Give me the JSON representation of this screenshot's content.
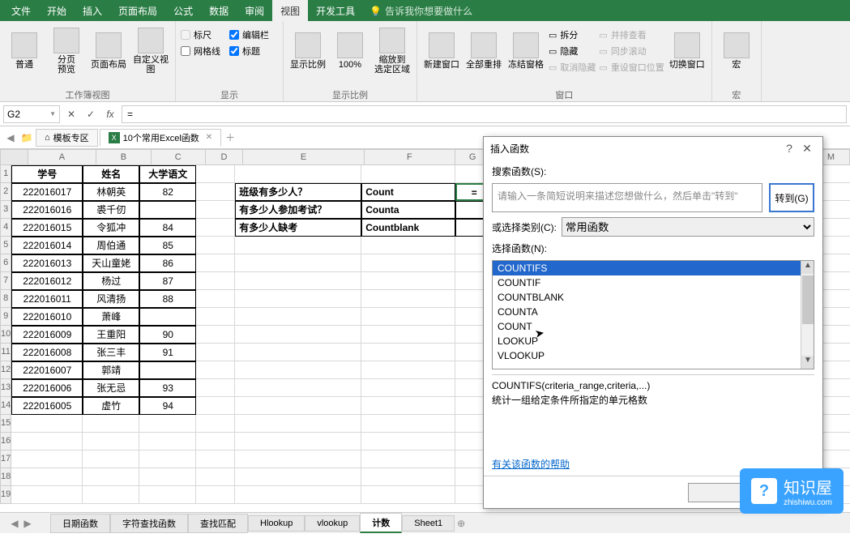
{
  "menu": {
    "tabs": [
      "文件",
      "开始",
      "插入",
      "页面布局",
      "公式",
      "数据",
      "审阅",
      "视图",
      "开发工具"
    ],
    "active": "视图",
    "tellme": "告诉我你想要做什么"
  },
  "ribbon": {
    "group1": {
      "label": "工作簿视图",
      "btns": [
        "普通",
        "分页\n预览",
        "页面布局",
        "自定义视图"
      ]
    },
    "group2": {
      "label": "显示",
      "chks": [
        "标尺",
        "编辑栏",
        "网格线",
        "标题"
      ]
    },
    "group3": {
      "label": "显示比例",
      "btns": [
        "显示比例",
        "100%",
        "缩放到\n选定区域"
      ]
    },
    "group4": {
      "label": "窗口",
      "btns": [
        "新建窗口",
        "全部重排",
        "冻结窗格"
      ],
      "rcol": [
        "拆分",
        "隐藏",
        "取消隐藏"
      ],
      "rcol2": [
        "并排查看",
        "同步滚动",
        "重设窗口位置"
      ],
      "switch": "切换窗口"
    },
    "group5": {
      "label": "宏",
      "btn": "宏"
    }
  },
  "formulaBar": {
    "nameBox": "G2",
    "formula": "="
  },
  "wbtabs": {
    "tab1": "模板专区",
    "tab2": "10个常用Excel函数"
  },
  "cols": [
    "A",
    "B",
    "C",
    "D",
    "E",
    "F",
    "G",
    "M"
  ],
  "grid": {
    "headers": {
      "A": "学号",
      "B": "姓名",
      "C": "大学语文"
    },
    "rows": [
      {
        "A": "222016017",
        "B": "林朝英",
        "C": "82"
      },
      {
        "A": "222016016",
        "B": "裘千仞",
        "C": ""
      },
      {
        "A": "222016015",
        "B": "令狐冲",
        "C": "84"
      },
      {
        "A": "222016014",
        "B": "周伯通",
        "C": "85"
      },
      {
        "A": "222016013",
        "B": "天山童姥",
        "C": "86"
      },
      {
        "A": "222016012",
        "B": "杨过",
        "C": "87"
      },
      {
        "A": "222016011",
        "B": "风清扬",
        "C": "88"
      },
      {
        "A": "222016010",
        "B": "萧峰",
        "C": ""
      },
      {
        "A": "222016009",
        "B": "王重阳",
        "C": "90"
      },
      {
        "A": "222016008",
        "B": "张三丰",
        "C": "91"
      },
      {
        "A": "222016007",
        "B": "郭靖",
        "C": ""
      },
      {
        "A": "222016006",
        "B": "张无忌",
        "C": "93"
      },
      {
        "A": "222016005",
        "B": "虚竹",
        "C": "94"
      }
    ],
    "side": [
      {
        "E": "班级有多少人？",
        "F": "Count",
        "G": "="
      },
      {
        "E": "有多少人参加考试？",
        "F": "Counta",
        "G": ""
      },
      {
        "E": "有多少人缺考",
        "F": "Countblank",
        "G": ""
      }
    ]
  },
  "sheetTabs": {
    "tabs": [
      "日期函数",
      "字符查找函数",
      "查找匹配",
      "Hlookup",
      "vlookup",
      "计数",
      "Sheet1"
    ],
    "active": "计数"
  },
  "dialog": {
    "title": "插入函数",
    "searchLabel": "搜索函数(S):",
    "searchPlaceholder": "请输入一条简短说明来描述您想做什么，然后单击\"转到\"",
    "goto": "转到(G)",
    "catLabel": "或选择类别(C):",
    "catValue": "常用函数",
    "selectLabel": "选择函数(N):",
    "functions": [
      "COUNTIFS",
      "COUNTIF",
      "COUNTBLANK",
      "COUNTA",
      "COUNT",
      "LOOKUP",
      "VLOOKUP"
    ],
    "selected": "COUNTIFS",
    "syntax": "COUNTIFS(criteria_range,criteria,...)",
    "description": "统计一组给定条件所指定的单元格数",
    "helpLink": "有关该函数的帮助"
  },
  "watermark": {
    "text": "知识屋",
    "sub": "zhishiwu.com"
  }
}
